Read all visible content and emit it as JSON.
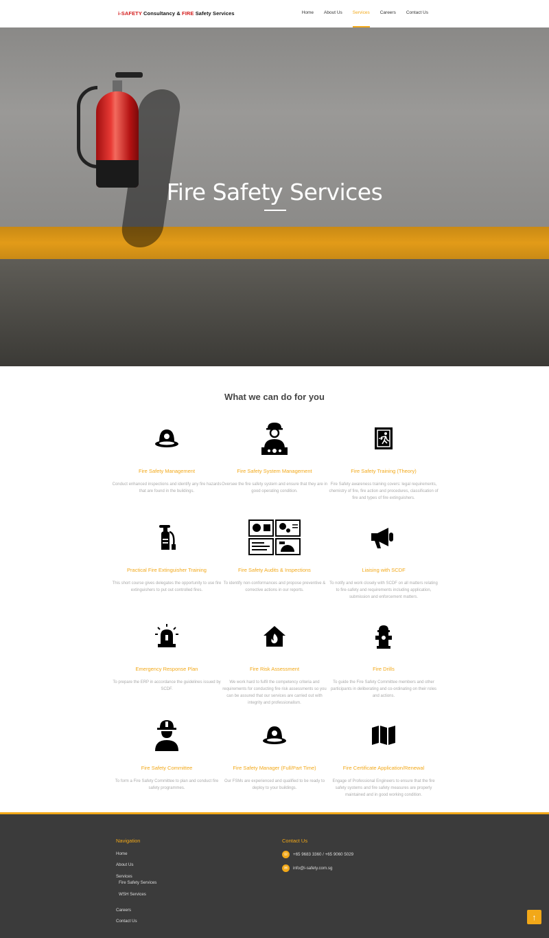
{
  "header": {
    "logo_prefix": "i-SAFETY",
    "logo_mid": " Consultancy & ",
    "logo_fire": "FIRE",
    "logo_suffix": " Safety Services",
    "nav": [
      "Home",
      "About Us",
      "Services",
      "Careers",
      "Contact Us"
    ],
    "active_nav": "Services"
  },
  "hero": {
    "title": "Fire Safety Services"
  },
  "main": {
    "section_title": "What we can do for you",
    "services": [
      {
        "title": "Fire Safety Management",
        "desc": "Conduct enhanced inspections and identify any fire  hazards that are found in the buildings.",
        "icon": "helmet-icon"
      },
      {
        "title": "Fire Safety System Management",
        "desc": "Oversee the fire safety system and ensure that they are in good operating condition.",
        "icon": "engineer-icon"
      },
      {
        "title": "Fire Safety Training (Theory)",
        "desc": "Fire Safety awareness training covers: legal requirements, chemistry of fire, fire action and procedures, classification of fire and types of fire extinguishers.",
        "icon": "exit-sign-icon"
      },
      {
        "title": "Practical Fire Extinguisher Training",
        "desc": "This short course gives delegates the opportunity to use fire extinguishers to put out controlled fires.",
        "icon": "fire-extinguisher-icon"
      },
      {
        "title": "Fire Safety Audits & Inspections",
        "desc": "To identify non-conformances and propose preventive & corrective actions in our reports.",
        "icon": "control-panel-icon"
      },
      {
        "title": "Liaising with SCDF",
        "desc": "To notify and work closely with SCDF on all matters relating to fire-safety and requirements including application, submission and enforcement matters.",
        "icon": "megaphone-icon"
      },
      {
        "title": "Emergency Response Plan",
        "desc": "To prepare the ERP in accordance the guidelines issued by SCDF.",
        "icon": "siren-icon"
      },
      {
        "title": "Fire Risk Assessment",
        "desc": "We work hard to fulfil the competency criteria and requirements for conducting fire risk assessments so you can be assured that our services are carried out with integrity and professionalism.",
        "icon": "house-fire-icon"
      },
      {
        "title": "Fire Drills",
        "desc": "To guide the Fire Safety Committee members and other participants in deliberating and co-ordinating on their roles and actions.",
        "icon": "hydrant-icon"
      },
      {
        "title": "Fire Safety Committee",
        "desc": "To form a Fire Safety Committee to plan and conduct fire safety programmes.",
        "icon": "firefighter-icon"
      },
      {
        "title": "Fire Safety Manager (Full/Part Time)",
        "desc": "Our FSMs are experienced and qualified to be ready to deploy  to your buildings.",
        "icon": "helmet-icon"
      },
      {
        "title": "Fire Certificate Application/Renewal",
        "desc": "Engage of Professional Engineers to ensure that the fire safety systems and fire safety measures are properly maintained and in good working condition.",
        "icon": "map-icon"
      }
    ]
  },
  "footer": {
    "nav_heading": "Navigation",
    "nav_items": [
      "Home",
      "About Us",
      "Services"
    ],
    "sub_items": [
      "Fire Safety Services",
      "WSH Services"
    ],
    "nav_items2": [
      "Careers",
      "Contact Us"
    ],
    "contact_heading": "Contact Us",
    "phone": "+65 9683 3360 / +65 9060 5029",
    "email": "info@i-safety.com.sg"
  },
  "colors": {
    "accent": "#f2a818",
    "brand_red": "#d41c1c",
    "footer_bg": "#3b3b3b"
  }
}
